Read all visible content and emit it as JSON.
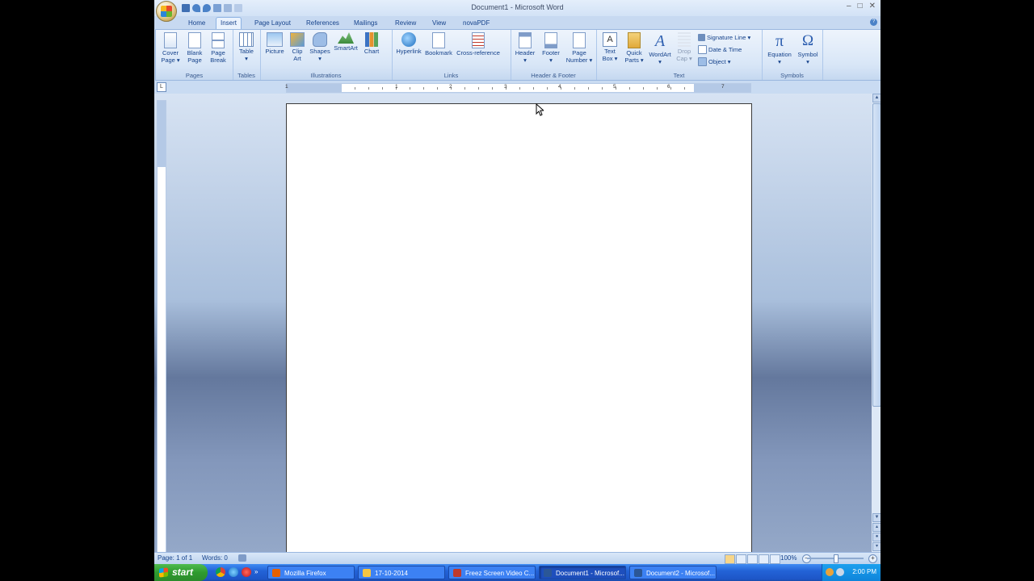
{
  "window": {
    "title": "Document1 - Microsoft Word",
    "controls": [
      "–",
      "□",
      "✕"
    ]
  },
  "quick_access_icons": [
    "save-icon",
    "undo-icon",
    "redo-icon",
    "spelling-icon",
    "print-preview-icon",
    "more-icon"
  ],
  "tabs": [
    {
      "label": "Home",
      "active": false
    },
    {
      "label": "Insert",
      "active": true
    },
    {
      "label": "Page Layout",
      "active": false
    },
    {
      "label": "References",
      "active": false
    },
    {
      "label": "Mailings",
      "active": false
    },
    {
      "label": "Review",
      "active": false
    },
    {
      "label": "View",
      "active": false
    },
    {
      "label": "novaPDF",
      "active": false
    }
  ],
  "ribbon": {
    "groups": {
      "pages": "Pages",
      "tables": "Tables",
      "illustrations": "Illustrations",
      "links": "Links",
      "header_footer": "Header & Footer",
      "text": "Text",
      "symbols": "Symbols"
    },
    "buttons": {
      "cover_page": [
        "Cover",
        "Page ▾"
      ],
      "blank_page": [
        "Blank",
        "Page"
      ],
      "page_break": [
        "Page",
        "Break"
      ],
      "table": [
        "Table",
        "▾"
      ],
      "picture": [
        "Picture",
        ""
      ],
      "clip_art": [
        "Clip",
        "Art"
      ],
      "shapes": [
        "Shapes",
        "▾"
      ],
      "smartart": [
        "SmartArt",
        ""
      ],
      "chart": [
        "Chart",
        ""
      ],
      "hyperlink": [
        "Hyperlink",
        ""
      ],
      "bookmark": [
        "Bookmark",
        ""
      ],
      "cross_reference": [
        "Cross-reference",
        ""
      ],
      "header": [
        "Header",
        "▾"
      ],
      "footer": [
        "Footer",
        "▾"
      ],
      "page_number": [
        "Page",
        "Number ▾"
      ],
      "text_box": [
        "Text",
        "Box ▾"
      ],
      "quick_parts": [
        "Quick",
        "Parts ▾"
      ],
      "wordart": [
        "WordArt",
        "▾"
      ],
      "drop_cap": [
        "Drop",
        "Cap ▾"
      ],
      "equation": [
        "Equation",
        "▾"
      ],
      "symbol": [
        "Symbol",
        "▾"
      ]
    },
    "small_buttons": {
      "signature_line": "Signature Line ▾",
      "date_time": "Date & Time",
      "object": "Object ▾"
    },
    "icon_glyphs": {
      "equation": "π",
      "symbol": "Ω",
      "wordart": "A",
      "text_box": "A"
    }
  },
  "ruler": {
    "tab_selector": "L",
    "numbers": [
      "1",
      "1",
      "2",
      "3",
      "4",
      "5",
      "6",
      "7"
    ]
  },
  "statusbar": {
    "page": "Page: 1 of 1",
    "words": "Words: 0",
    "zoom": "100%",
    "zoom_minus": "−",
    "zoom_plus": "+",
    "zoom_level": 100
  },
  "taskbar": {
    "start": "start",
    "tasks": [
      {
        "label": "Mozilla Firefox",
        "active": false,
        "icon": "firefox-icon",
        "color": "#e66000"
      },
      {
        "label": "17-10-2014",
        "active": false,
        "icon": "folder-icon",
        "color": "#f5c542"
      },
      {
        "label": "Freez Screen Video C...",
        "active": false,
        "icon": "video-capture-icon",
        "color": "#c0392b"
      },
      {
        "label": "Document1 - Microsof...",
        "active": true,
        "icon": "word-icon",
        "color": "#2b5797"
      },
      {
        "label": "Document2 - Microsof...",
        "active": false,
        "icon": "word-icon",
        "color": "#2b5797"
      }
    ],
    "clock": "2:00 PM"
  },
  "colors": {
    "ribbon_text": "#15428b",
    "taskbar_blue": "#2363d7",
    "start_green": "#2f9b2f"
  }
}
